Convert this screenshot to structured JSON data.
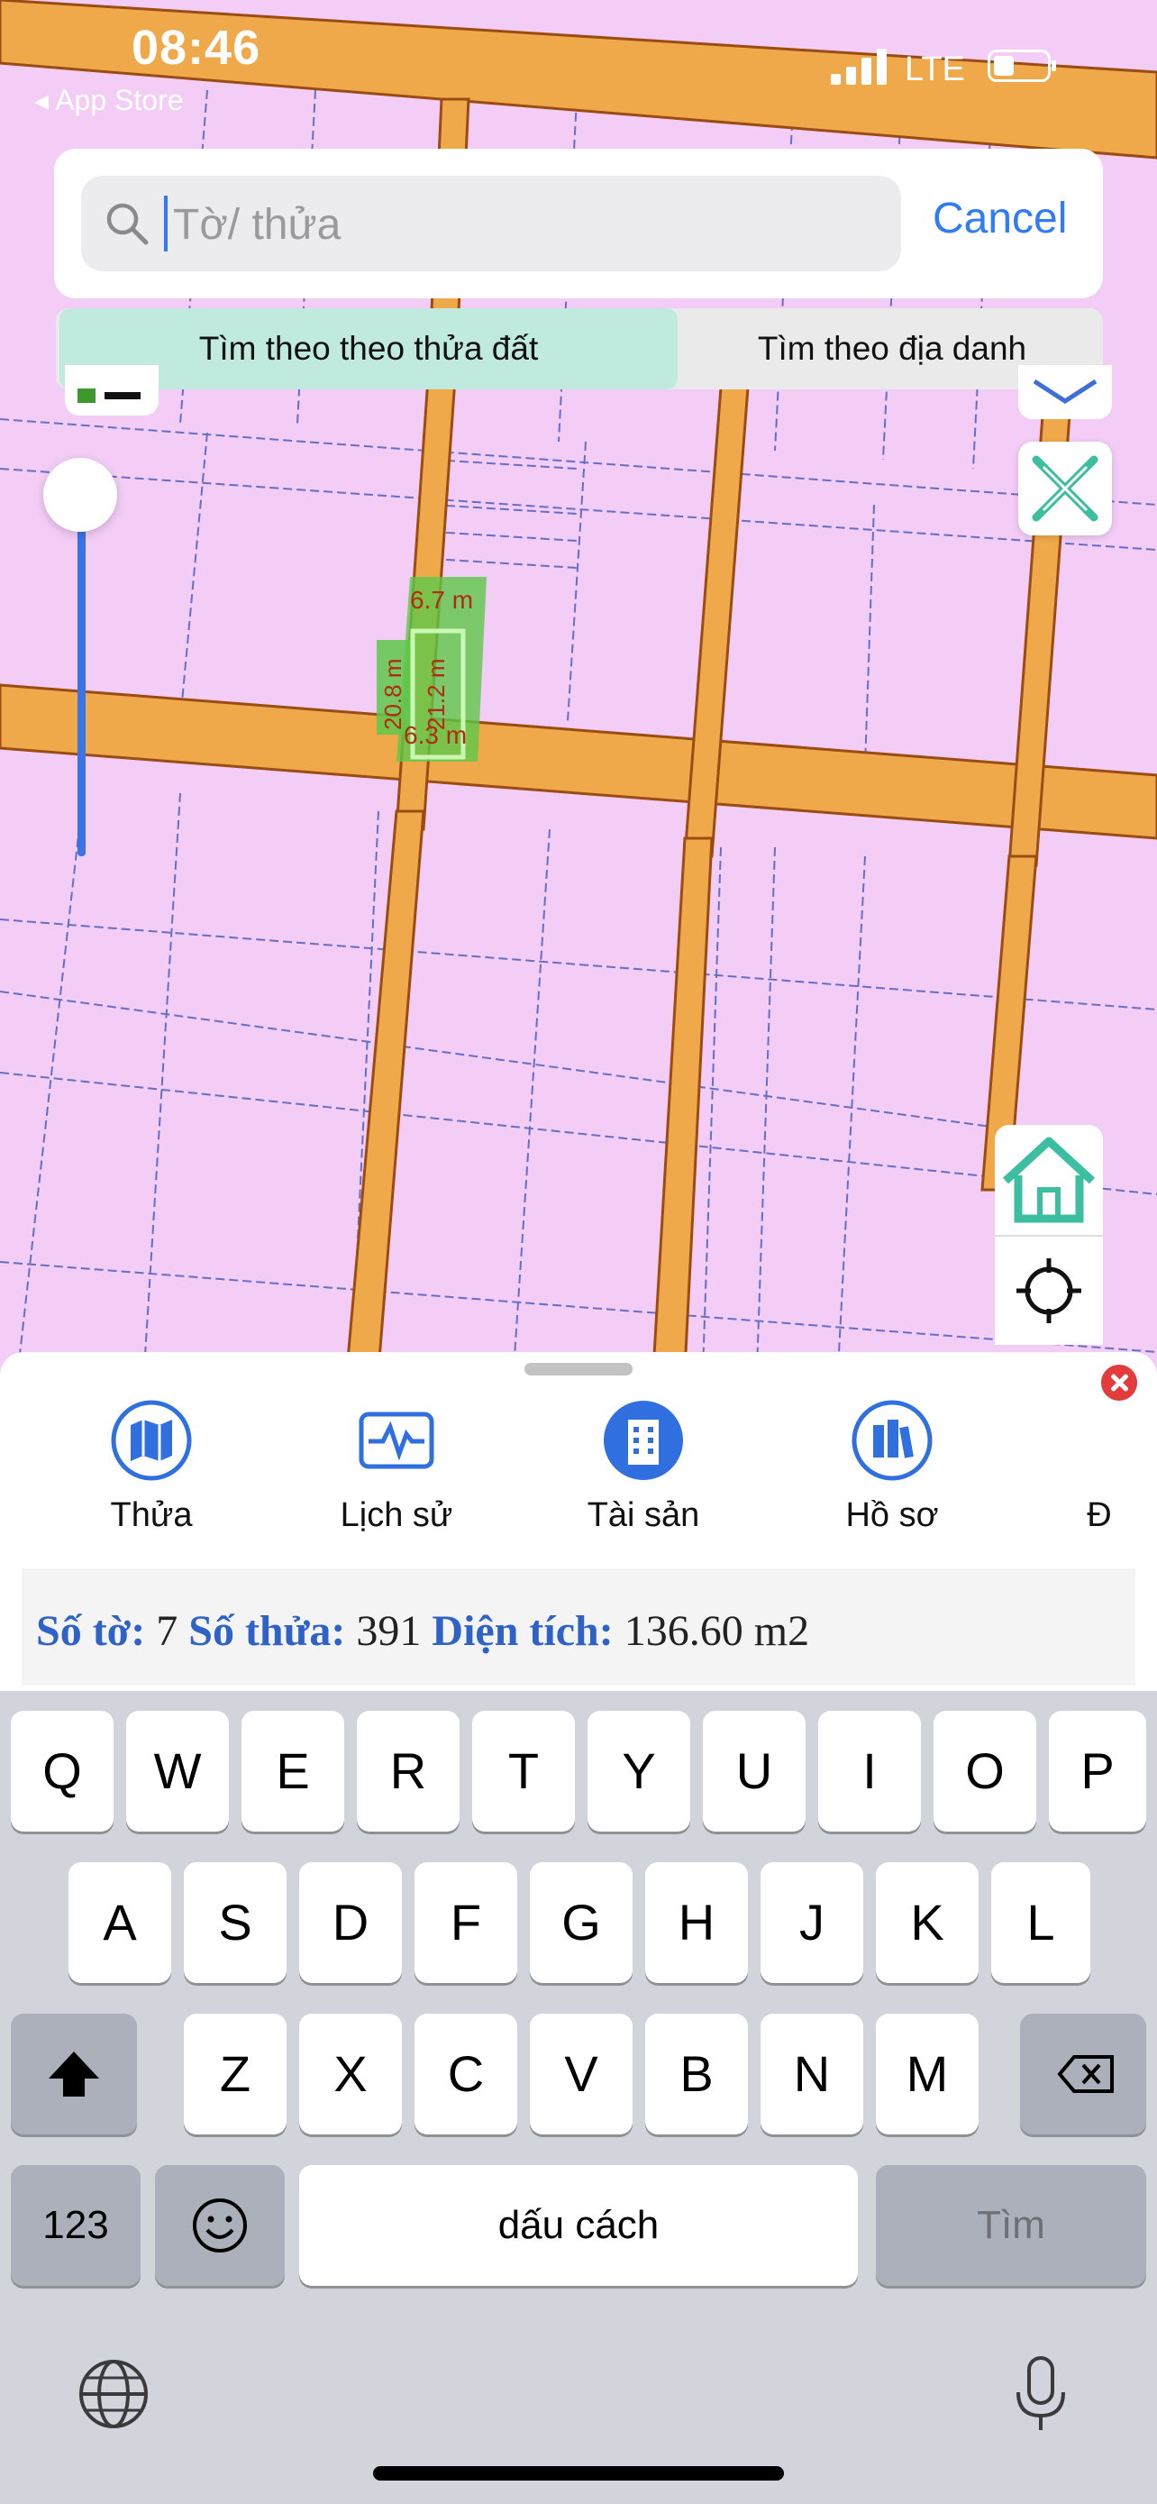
{
  "status": {
    "time": "08:46",
    "back_app": "◂ App Store",
    "network": "LTE"
  },
  "search": {
    "placeholder": "Tờ/ thửa",
    "value": "",
    "cancel_label": "Cancel"
  },
  "tabs": {
    "active": "Tìm theo theo thửa đất",
    "other": "Tìm theo địa danh"
  },
  "map": {
    "measurements": [
      "6.7 m",
      "20.8 m",
      "21.2 m",
      "6.3 m"
    ],
    "colors": {
      "land": "#f3cdf6",
      "road": "#f0a94a",
      "parcel_highlight": "#5ec84a"
    }
  },
  "map_controls": [
    "layers-button",
    "measure-tool-button",
    "home-button",
    "locate-button"
  ],
  "sheet": {
    "tabs": [
      {
        "label": "Thửa",
        "icon": "map-icon"
      },
      {
        "label": "Lịch sử",
        "icon": "activity-icon"
      },
      {
        "label": "Tài sản",
        "icon": "building-icon"
      },
      {
        "label": "Hồ sơ",
        "icon": "books-icon"
      },
      {
        "label": "Đ",
        "icon": "partial-icon"
      }
    ],
    "info": {
      "so_to_label": "Số tờ:",
      "so_to": "7",
      "so_thua_label": "Số thửa:",
      "so_thua": "391",
      "dien_tich_label": "Diện tích:",
      "dien_tich": "136.60 m2"
    }
  },
  "keyboard": {
    "row1": [
      "Q",
      "W",
      "E",
      "R",
      "T",
      "Y",
      "U",
      "I",
      "O",
      "P"
    ],
    "row2": [
      "A",
      "S",
      "D",
      "F",
      "G",
      "H",
      "J",
      "K",
      "L"
    ],
    "row3": [
      "Z",
      "X",
      "C",
      "V",
      "B",
      "N",
      "M"
    ],
    "numbers": "123",
    "space": "dấu cách",
    "return": "Tìm"
  }
}
